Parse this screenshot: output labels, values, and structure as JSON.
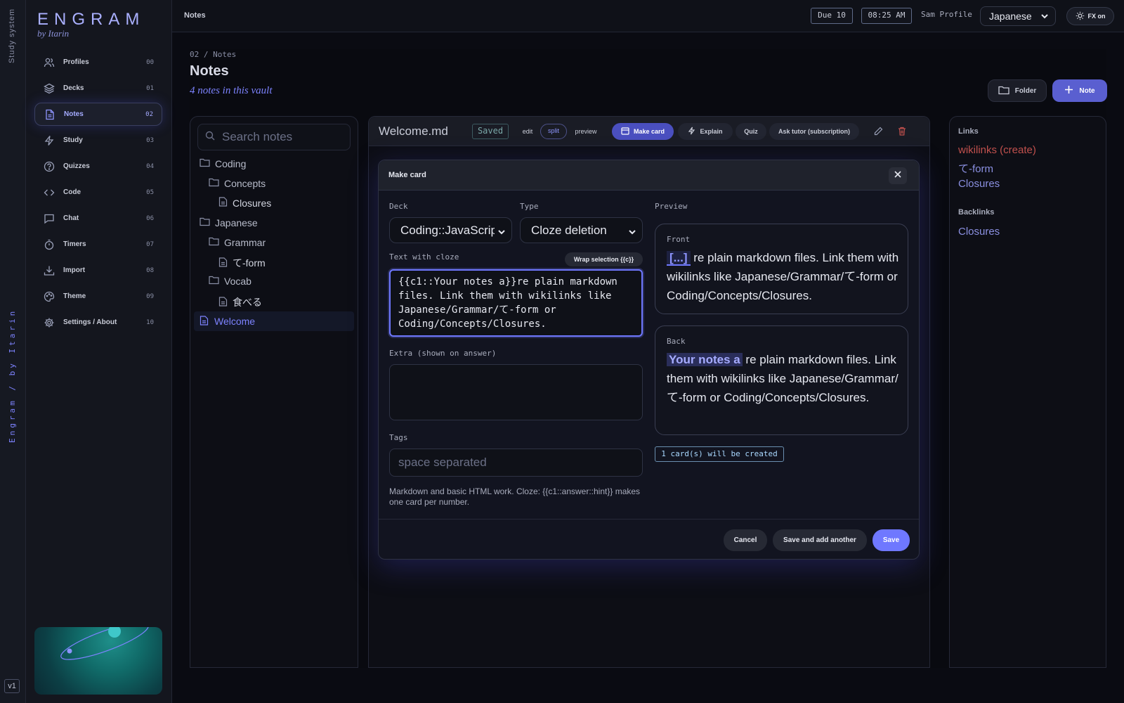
{
  "rail": {
    "tagline": "Study system",
    "brand_vertical": "Engram / by Itarin",
    "version": "v1"
  },
  "sidebar": {
    "logo": "ENGRAM",
    "logo_sub": "by Itarin",
    "items": [
      {
        "label": "Profiles",
        "num": "00",
        "icon": "profiles-icon"
      },
      {
        "label": "Decks",
        "num": "01",
        "icon": "layers-icon"
      },
      {
        "label": "Notes",
        "num": "02",
        "icon": "note-icon",
        "active": true
      },
      {
        "label": "Study",
        "num": "03",
        "icon": "bolt-icon"
      },
      {
        "label": "Quizzes",
        "num": "04",
        "icon": "question-icon"
      },
      {
        "label": "Code",
        "num": "05",
        "icon": "code-icon"
      },
      {
        "label": "Chat",
        "num": "06",
        "icon": "chat-icon"
      },
      {
        "label": "Timers",
        "num": "07",
        "icon": "timer-icon"
      },
      {
        "label": "Import",
        "num": "08",
        "icon": "download-icon"
      },
      {
        "label": "Theme",
        "num": "09",
        "icon": "palette-icon"
      },
      {
        "label": "Settings / About",
        "num": "10",
        "icon": "gear-icon"
      }
    ]
  },
  "topbar": {
    "crumb": "Notes",
    "due": "Due 10",
    "time": "08:25 AM",
    "profile": "Sam Profile",
    "language": "Japanese",
    "fx": "FX on"
  },
  "main": {
    "path": "02 / Notes",
    "title": "Notes",
    "subtitle": "4 notes in this vault",
    "folder_button": "Folder",
    "note_button": "Note"
  },
  "tree": {
    "search_placeholder": "Search notes",
    "items": [
      {
        "label": "Coding",
        "kind": "folder"
      },
      {
        "label": "Concepts",
        "kind": "folder"
      },
      {
        "label": "Closures",
        "kind": "file"
      },
      {
        "label": "Japanese",
        "kind": "folder"
      },
      {
        "label": "Grammar",
        "kind": "folder"
      },
      {
        "label": "て-form",
        "kind": "file"
      },
      {
        "label": "Vocab",
        "kind": "folder"
      },
      {
        "label": "食べる",
        "kind": "file"
      },
      {
        "label": "Welcome",
        "kind": "file",
        "selected": true
      }
    ]
  },
  "editor": {
    "filename": "Welcome.md",
    "status": "Saved",
    "modes": [
      "edit",
      "split",
      "preview"
    ],
    "active_mode": "split",
    "toolbar": {
      "make_card": "Make card",
      "explain": "Explain",
      "quiz": "Quiz",
      "ask_tutor": "Ask tutor (subscription)"
    }
  },
  "modal": {
    "title": "Make card",
    "deck_label": "Deck",
    "deck_value": "Coding::JavaScript",
    "type_label": "Type",
    "type_value": "Cloze deletion",
    "cloze_label": "Text with cloze",
    "wrap_button": "Wrap selection {{c}}",
    "cloze_text": "{{c1::Your notes a}}re plain markdown files. Link them with wikilinks like Japanese/Grammar/て-form or Coding/Concepts/Closures.",
    "extra_label": "Extra (shown on answer)",
    "tags_label": "Tags",
    "tags_placeholder": "space separated",
    "hint": "Markdown and basic HTML work. Cloze: {{c1::answer::hint}} makes one card per number.",
    "preview_label": "Preview",
    "front_label": "Front",
    "front_cloze": "[...]",
    "front_rest": " re plain markdown files. Link them with wikilinks like Japanese/Grammar/て-form or Coding/Concepts/Closures.",
    "back_label": "Back",
    "back_cloze": "Your notes a",
    "back_rest": " re plain markdown files. Link them with wikilinks like Japanese/Grammar/て-form or Coding/Concepts/Closures.",
    "will_create": "1 card(s) will be created",
    "cancel": "Cancel",
    "save_add": "Save and add another",
    "save": "Save"
  },
  "links": {
    "links_title": "Links",
    "links": [
      {
        "label": "wikilinks (create)",
        "color": "#c0504d"
      },
      {
        "label": "て-form",
        "color": "#8a8fe0"
      },
      {
        "label": "Closures",
        "color": "#8a8fe0"
      }
    ],
    "backlinks_title": "Backlinks",
    "backlinks": [
      {
        "label": "Closures"
      }
    ]
  },
  "colors": {
    "accent": "#5a5fd0",
    "accent_light": "#8e95ff",
    "missing_link": "#c0504d",
    "bg": "#0a0b12"
  }
}
